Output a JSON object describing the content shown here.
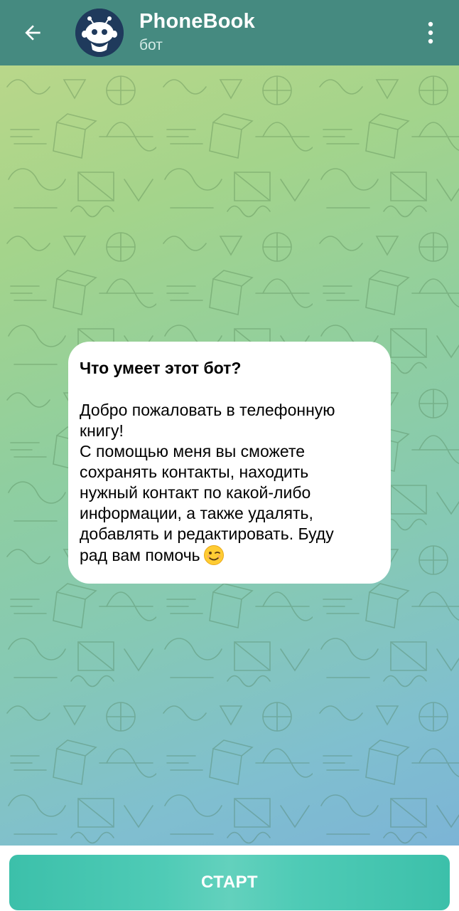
{
  "header": {
    "title": "PhoneBook",
    "subtitle": "бот",
    "back_icon": "arrow-left-icon",
    "menu_icon": "more-vertical-icon",
    "avatar_icon": "robot-avatar"
  },
  "message": {
    "heading": "Что умеет этот бот?",
    "lines": [
      "Добро пожаловать в телефонную",
      "книгу!",
      "С помощью меня вы сможете",
      "сохранять контакты, находить",
      "нужный контакт по какой-либо",
      "информации, а также удалять,",
      "добавлять и редактировать. Буду",
      "рад вам помочь"
    ],
    "emoji": "winking-face-emoji"
  },
  "bottom": {
    "start_label": "СТАРТ"
  },
  "colors": {
    "header_bg": "#458a80",
    "button_accent": "#45c4ae",
    "bg_gradient_start": "#b9d78a",
    "bg_gradient_end": "#7cb4d6"
  }
}
